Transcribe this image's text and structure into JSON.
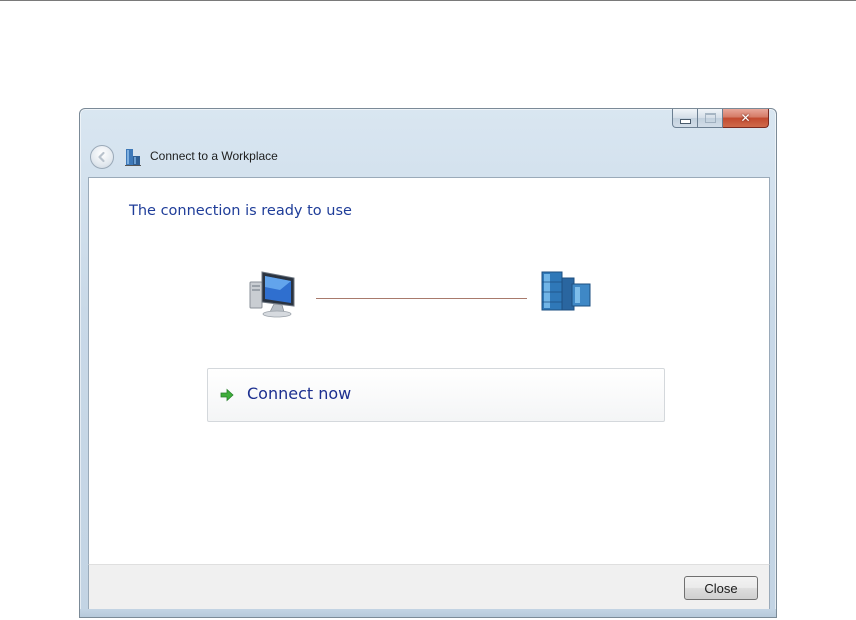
{
  "window": {
    "title": "Connect to a Workplace",
    "caption_icons": [
      "minimize-icon",
      "maximize-icon",
      "close-icon"
    ]
  },
  "main": {
    "heading": "The connection is ready to use",
    "illustration_icons": [
      "computer-icon",
      "server-building-icon"
    ],
    "command_link": {
      "label": "Connect now",
      "icon": "green-arrow-icon"
    }
  },
  "footer": {
    "close_label": "Close"
  },
  "colors": {
    "heading": "#1f3d99",
    "command_label": "#1c2f8f",
    "connection_line": "#a87a6c",
    "close_caption": "#c24a30"
  }
}
